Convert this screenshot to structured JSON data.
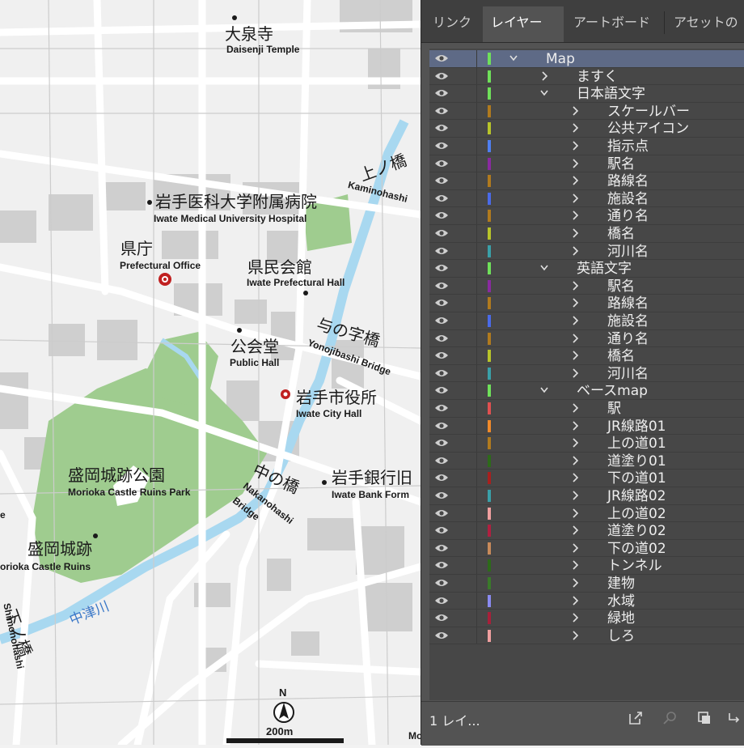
{
  "map": {
    "labels": [
      {
        "id": "daisenji-jp",
        "text": "大泉寺"
      },
      {
        "id": "daisenji-en",
        "text": "Daisenji Temple"
      },
      {
        "id": "hospital-jp",
        "text": "岩手医科大学附属病院"
      },
      {
        "id": "hospital-en",
        "text": "Iwate Medical University Hospital"
      },
      {
        "id": "kencho-jp",
        "text": "県庁"
      },
      {
        "id": "kencho-en",
        "text": "Prefectural Office"
      },
      {
        "id": "kenmin-jp",
        "text": "県民会館"
      },
      {
        "id": "kenmin-en",
        "text": "Iwate Prefectural Hall"
      },
      {
        "id": "kamino-jp",
        "text": "上ノ橋"
      },
      {
        "id": "kamino-en",
        "text": "Kaminohashi"
      },
      {
        "id": "yonoji-jp",
        "text": "与の字橋"
      },
      {
        "id": "yonoji-en",
        "text": "Yonojibashi Bridge"
      },
      {
        "id": "kokaido-jp",
        "text": "公会堂"
      },
      {
        "id": "kokaido-en",
        "text": "Public Hall"
      },
      {
        "id": "cityhall-jp",
        "text": "岩手市役所"
      },
      {
        "id": "cityhall-en",
        "text": "Iwate City Hall"
      },
      {
        "id": "bank-jp",
        "text": "岩手銀行旧"
      },
      {
        "id": "bank-en",
        "text": "Iwate Bank Form"
      },
      {
        "id": "park-jp",
        "text": "盛岡城跡公園"
      },
      {
        "id": "park-en",
        "text": "Morioka Castle Ruins Park"
      },
      {
        "id": "nakano-jp",
        "text": "中の橋"
      },
      {
        "id": "nakano-en1",
        "text": "Nakanohashi"
      },
      {
        "id": "nakano-en2",
        "text": "Bridge"
      },
      {
        "id": "ruins-jp",
        "text": "盛岡城跡"
      },
      {
        "id": "ruins-en",
        "text": "orioka Castle Ruins"
      },
      {
        "id": "nakatsu-jp",
        "text": "中津川"
      },
      {
        "id": "shimono-jp",
        "text": "下ノ橋"
      },
      {
        "id": "shimono-en",
        "text": "Shimonohashi"
      },
      {
        "id": "left-e",
        "text": "e"
      },
      {
        "id": "bottom-mo",
        "text": "Mo"
      }
    ],
    "north_label": "N",
    "scale_label": "200m"
  },
  "panel": {
    "tabs": [
      {
        "label": "リンク",
        "active": false
      },
      {
        "label": "レイヤー",
        "active": true
      },
      {
        "label": "アートボード",
        "active": false
      },
      {
        "label": "アセットの",
        "active": false
      }
    ],
    "layers": [
      {
        "name": "Map",
        "level": 0,
        "expanded": true,
        "color": "#6fe05a",
        "selected": true
      },
      {
        "name": "ますく",
        "level": 1,
        "expanded": false,
        "color": "#6fe05a"
      },
      {
        "name": "日本語文字",
        "level": 1,
        "expanded": true,
        "color": "#6fe05a"
      },
      {
        "name": "スケールバー",
        "level": 2,
        "expanded": false,
        "color": "#b07a1e"
      },
      {
        "name": "公共アイコン",
        "level": 2,
        "expanded": false,
        "color": "#b8c42a"
      },
      {
        "name": "指示点",
        "level": 2,
        "expanded": false,
        "color": "#4f7ff0"
      },
      {
        "name": "駅名",
        "level": 2,
        "expanded": false,
        "color": "#8a2aa0"
      },
      {
        "name": "路線名",
        "level": 2,
        "expanded": false,
        "color": "#b07a1e"
      },
      {
        "name": "施設名",
        "level": 2,
        "expanded": false,
        "color": "#4a6ae8"
      },
      {
        "name": "通り名",
        "level": 2,
        "expanded": false,
        "color": "#b07a1e"
      },
      {
        "name": "橋名",
        "level": 2,
        "expanded": false,
        "color": "#b8c42a"
      },
      {
        "name": "河川名",
        "level": 2,
        "expanded": false,
        "color": "#3aa0a8"
      },
      {
        "name": "英語文字",
        "level": 1,
        "expanded": true,
        "color": "#6fe05a"
      },
      {
        "name": "駅名",
        "level": 2,
        "expanded": false,
        "color": "#8a2aa0"
      },
      {
        "name": "路線名",
        "level": 2,
        "expanded": false,
        "color": "#b07a1e"
      },
      {
        "name": "施設名",
        "level": 2,
        "expanded": false,
        "color": "#4a6ae8"
      },
      {
        "name": "通り名",
        "level": 2,
        "expanded": false,
        "color": "#b07a1e"
      },
      {
        "name": "橋名",
        "level": 2,
        "expanded": false,
        "color": "#b8c42a"
      },
      {
        "name": "河川名",
        "level": 2,
        "expanded": false,
        "color": "#3aa0a8"
      },
      {
        "name": "ベースmap",
        "level": 1,
        "expanded": true,
        "color": "#6fe05a"
      },
      {
        "name": "駅",
        "level": 2,
        "expanded": false,
        "color": "#e05050"
      },
      {
        "name": "JR線路01",
        "level": 2,
        "expanded": false,
        "color": "#f08a2a"
      },
      {
        "name": "上の道01",
        "level": 2,
        "expanded": false,
        "color": "#b07a1e"
      },
      {
        "name": "道塗り01",
        "level": 2,
        "expanded": false,
        "color": "#2d6a1a"
      },
      {
        "name": "下の道01",
        "level": 2,
        "expanded": false,
        "color": "#a8201e"
      },
      {
        "name": "JR線路02",
        "level": 2,
        "expanded": false,
        "color": "#3aa0a8"
      },
      {
        "name": "上の道02",
        "level": 2,
        "expanded": false,
        "color": "#f0a0a0"
      },
      {
        "name": "道塗り02",
        "level": 2,
        "expanded": false,
        "color": "#b02040"
      },
      {
        "name": "下の道02",
        "level": 2,
        "expanded": false,
        "color": "#c88a5a"
      },
      {
        "name": "トンネル",
        "level": 2,
        "expanded": false,
        "color": "#2d6a1a"
      },
      {
        "name": "建物",
        "level": 2,
        "expanded": false,
        "color": "#3a7a2a"
      },
      {
        "name": "水域",
        "level": 2,
        "expanded": false,
        "color": "#8a8af0"
      },
      {
        "name": "緑地",
        "level": 2,
        "expanded": false,
        "color": "#a8203a"
      },
      {
        "name": "しろ",
        "level": 2,
        "expanded": false,
        "color": "#f0a0a0"
      }
    ],
    "footer": {
      "count_label": "1 レイ..."
    }
  }
}
